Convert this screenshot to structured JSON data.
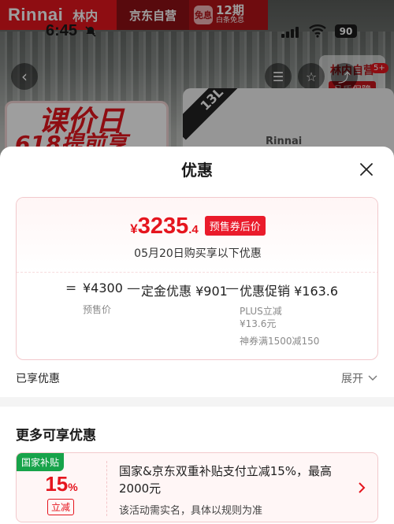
{
  "background": {
    "brand": {
      "en": "Rinnai",
      "cn": "林内"
    },
    "jd_self": "京东自营",
    "installment": {
      "badge": "免息",
      "title": "12期",
      "subtitle": "白条免息"
    },
    "status": {
      "time": "6:45",
      "battery": "90"
    },
    "store_badge": {
      "name": "林内自营",
      "tagline": "品质保障"
    },
    "cart_count": "5+",
    "promo": {
      "line1": "课价日",
      "line2": "618提前享"
    },
    "product": {
      "ribbon": "13L",
      "brand": "Rinnai"
    }
  },
  "sheet": {
    "title": "优惠",
    "price": {
      "currency": "¥",
      "integer": "3235",
      "decimal": ".4",
      "tag": "预售券后价",
      "subtitle": "05月20日购买享以下优惠"
    },
    "formula": {
      "eq": "=",
      "presale_price": "¥4300",
      "presale_label": "预售价",
      "minus1": "—",
      "deposit": "定金优惠 ¥901",
      "minus2": "—",
      "promo": "优惠促销 ¥163.6",
      "promo_items": [
        "PLUS立减",
        "¥13.6元",
        "神券满1500减150"
      ]
    },
    "enjoyed_label": "已享优惠",
    "expand_label": "展开",
    "more_title": "更多可享优惠",
    "subsidy": {
      "tag": "国家补贴",
      "percent": "15",
      "percent_sign": "%",
      "reduce_tag": "立减",
      "description": "国家&京东双重补贴支付立减15%，最高2000元",
      "note": "该活动需实名，具体以规则为准"
    }
  },
  "colors": {
    "accent": "#e5151e",
    "green_tag": "#17a34a",
    "border_pink": "#f2c9cc"
  }
}
